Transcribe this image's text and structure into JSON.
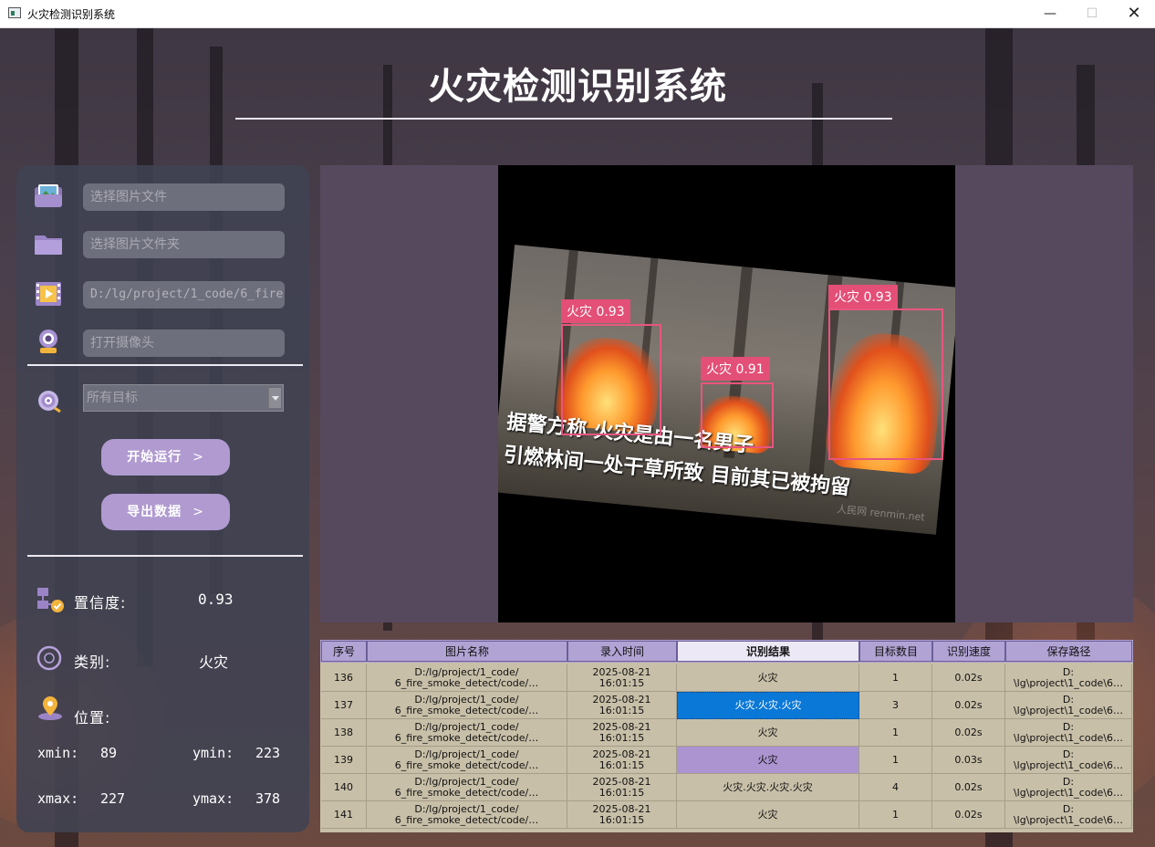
{
  "window": {
    "title": "火灾检测识别系统",
    "min": "—",
    "max": "☐",
    "close": "✕"
  },
  "app_title": "火灾检测识别系统",
  "inputs": {
    "image_file": "选择图片文件",
    "image_folder": "选择图片文件夹",
    "video_path": "D:/lg/project/1_code/6_fire",
    "camera": "打开摄像头"
  },
  "target_select": {
    "value": "所有目标"
  },
  "buttons": {
    "start": "开始运行",
    "export": "导出数据",
    "chevron": ">"
  },
  "info": {
    "confidence_label": "置信度:",
    "confidence_value": "0.93",
    "class_label": "类别:",
    "class_value": "火灾",
    "position_label": "位置:",
    "xmin_label": "xmin:",
    "xmin": "89",
    "ymin_label": "ymin:",
    "ymin": "223",
    "xmax_label": "xmax:",
    "xmax": "227",
    "ymax_label": "ymax:",
    "ymax": "378"
  },
  "viewer": {
    "caption_line1": "据警方称 火灾是由一名男子",
    "caption_line2": "引燃林间一处干草所致 目前其已被拘留",
    "watermark": "人民网 renmin.net",
    "detections": [
      {
        "label": "火灾 0.93"
      },
      {
        "label": "火灾 0.91"
      },
      {
        "label": "火灾 0.93"
      }
    ]
  },
  "table": {
    "headers": [
      "序号",
      "图片名称",
      "录入时间",
      "识别结果",
      "目标数目",
      "识别速度",
      "保存路径"
    ],
    "rows": [
      {
        "id": "136",
        "name1": "D:/lg/project/1_code/",
        "name2": "6_fire_smoke_detect/code/…",
        "date": "2025-08-21",
        "time": "16:01:15",
        "result": "火灾",
        "count": "1",
        "speed": "0.02s",
        "path1": "D:",
        "path2": "\\lg\\project\\1_code\\6…"
      },
      {
        "id": "137",
        "name1": "D:/lg/project/1_code/",
        "name2": "6_fire_smoke_detect/code/…",
        "date": "2025-08-21",
        "time": "16:01:15",
        "result": "火灾.火灾.火灾",
        "count": "3",
        "speed": "0.02s",
        "path1": "D:",
        "path2": "\\lg\\project\\1_code\\6…"
      },
      {
        "id": "138",
        "name1": "D:/lg/project/1_code/",
        "name2": "6_fire_smoke_detect/code/…",
        "date": "2025-08-21",
        "time": "16:01:15",
        "result": "火灾",
        "count": "1",
        "speed": "0.02s",
        "path1": "D:",
        "path2": "\\lg\\project\\1_code\\6…"
      },
      {
        "id": "139",
        "name1": "D:/lg/project/1_code/",
        "name2": "6_fire_smoke_detect/code/…",
        "date": "2025-08-21",
        "time": "16:01:15",
        "result": "火灾",
        "count": "1",
        "speed": "0.03s",
        "path1": "D:",
        "path2": "\\lg\\project\\1_code\\6…"
      },
      {
        "id": "140",
        "name1": "D:/lg/project/1_code/",
        "name2": "6_fire_smoke_detect/code/…",
        "date": "2025-08-21",
        "time": "16:01:15",
        "result": "火灾.火灾.火灾.火灾",
        "count": "4",
        "speed": "0.02s",
        "path1": "D:",
        "path2": "\\lg\\project\\1_code\\6…"
      },
      {
        "id": "141",
        "name1": "D:/lg/project/1_code/",
        "name2": "6_fire_smoke_detect/code/…",
        "date": "2025-08-21",
        "time": "16:01:15",
        "result": "火灾",
        "count": "1",
        "speed": "0.02s",
        "path1": "D:",
        "path2": "\\lg\\project\\1_code\\6…"
      }
    ]
  },
  "colors": {
    "accent": "#b09ad0",
    "panel": "#404252",
    "detect_box": "#e8557e",
    "selection": "#0a78d7"
  },
  "icons": [
    "image-file-icon",
    "folder-icon",
    "video-icon",
    "webcam-icon",
    "target-icon",
    "confidence-icon",
    "class-icon",
    "location-icon"
  ]
}
